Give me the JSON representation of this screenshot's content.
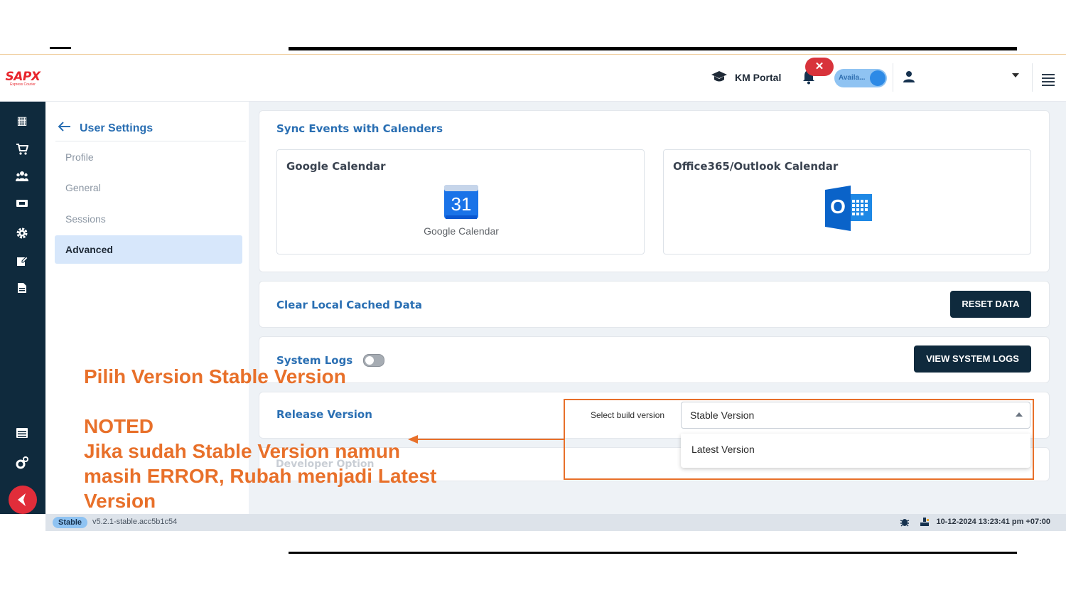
{
  "header": {
    "logo_text": "SAPX",
    "logo_sub": "Express Courier",
    "km_portal": "KM Portal",
    "close_badge": "✕",
    "availability_label": "Availa..."
  },
  "settings": {
    "title": "User Settings",
    "items": [
      {
        "label": "Profile"
      },
      {
        "label": "General"
      },
      {
        "label": "Sessions"
      },
      {
        "label": "Advanced"
      }
    ]
  },
  "sync": {
    "title": "Sync Events with Calenders",
    "google_title": "Google Calendar",
    "google_icon_day": "31",
    "google_caption": "Google Calendar",
    "outlook_title": "Office365/Outlook Calendar",
    "outlook_letter": "O"
  },
  "cache": {
    "title": "Clear Local Cached Data",
    "button": "RESET DATA"
  },
  "logs": {
    "title": "System Logs",
    "button": "VIEW SYSTEM LOGS"
  },
  "release": {
    "title": "Release Version",
    "select_label": "Select build version",
    "selected": "Stable Version",
    "options": [
      "Stable Version",
      "Latest Version"
    ]
  },
  "developer": {
    "title": "Developer Option"
  },
  "statusbar": {
    "badge": "Stable",
    "version": "v5.2.1-stable.acc5b1c54",
    "timestamp": "10-12-2024 13:23:41 pm +07:00"
  },
  "annotations": {
    "line1": "Pilih Version Stable Version",
    "line2": "NOTED",
    "line3": "Jika sudah Stable Version namun",
    "line4": "masih ERROR, Rubah menjadi Latest",
    "line5": "Version",
    "color": "#e8702a"
  },
  "colors": {
    "nav": "#0f2a3d",
    "accent": "#2a6fb3",
    "highlight": "#e8702a"
  }
}
